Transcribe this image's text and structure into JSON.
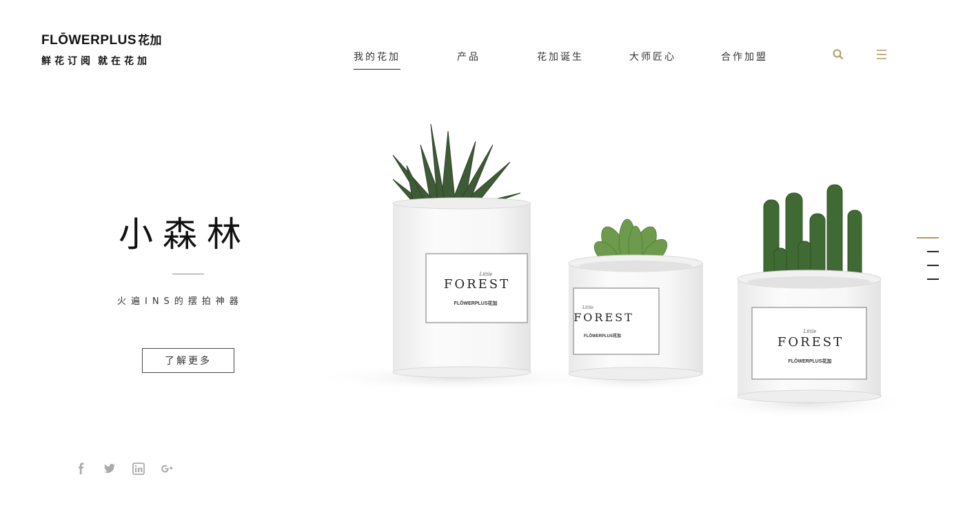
{
  "logo": {
    "brand": "FLŌWERPLUS",
    "brand_cn": "花加",
    "slogan_part1": "鲜花订阅",
    "slogan_part2": "就在花加"
  },
  "nav": {
    "items": [
      {
        "label": "我的花加",
        "active": true
      },
      {
        "label": "产品",
        "active": false
      },
      {
        "label": "花加诞生",
        "active": false
      },
      {
        "label": "大师匠心",
        "active": false
      },
      {
        "label": "合作加盟",
        "active": false
      }
    ]
  },
  "header_icons": {
    "search": "search-icon",
    "menu": "menu-icon"
  },
  "hero": {
    "title": "小森林",
    "subtitle": "火遍INS的摆拍神器",
    "button_label": "了解更多"
  },
  "product_label": {
    "small_script": "Little",
    "name": "FOREST",
    "brand": "FLŌWERPLUS花加"
  },
  "slides": {
    "count": 4,
    "active_index": 0
  },
  "social": [
    "facebook-icon",
    "twitter-icon",
    "linkedin-icon",
    "google-plus-icon"
  ],
  "colors": {
    "accent": "#b59a62",
    "text": "#222222",
    "background": "#ffffff"
  }
}
